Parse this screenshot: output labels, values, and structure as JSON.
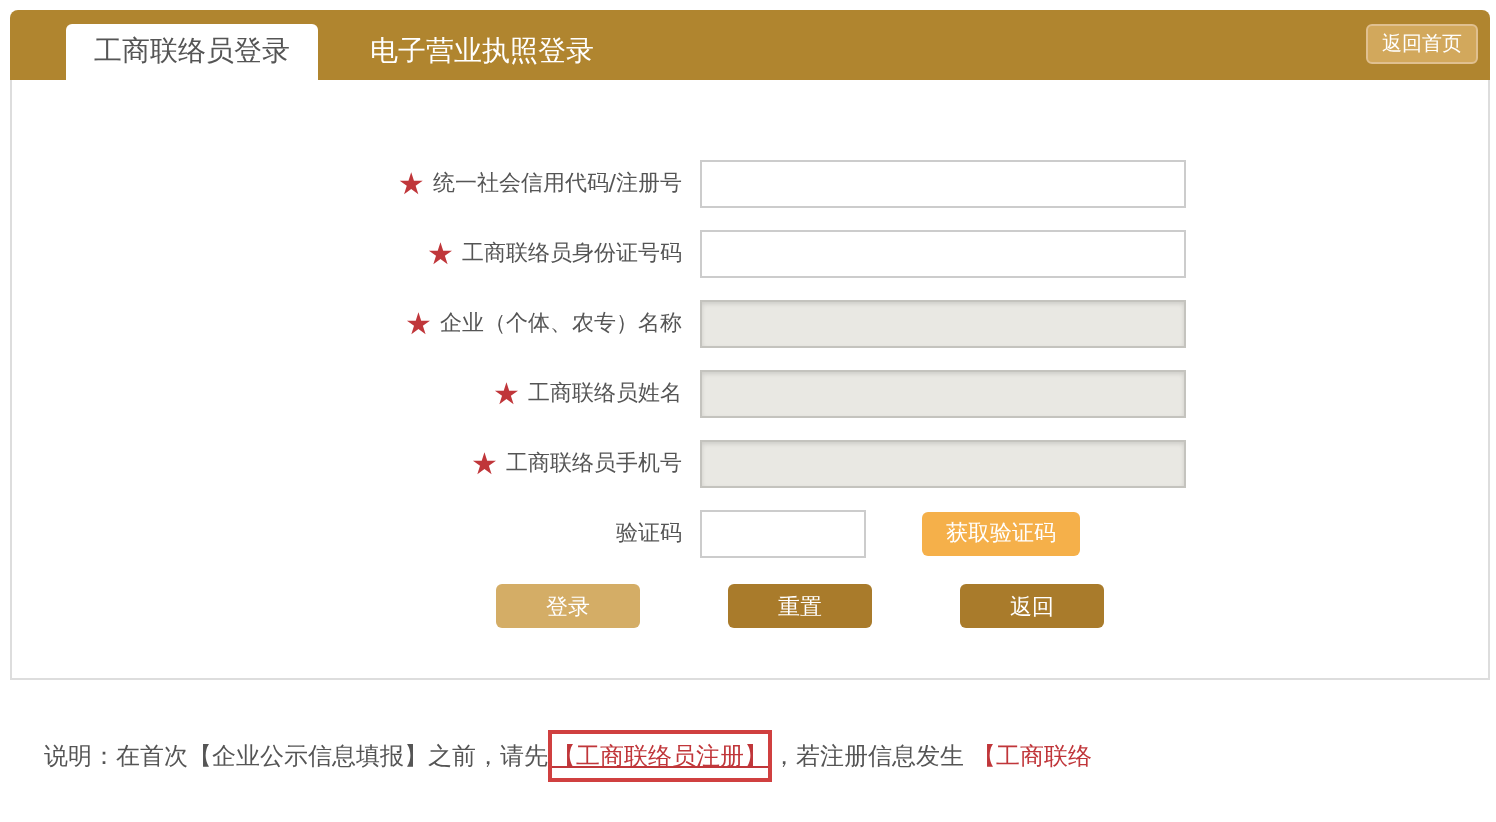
{
  "tabs": [
    {
      "label": "工商联络员登录",
      "selected": true
    },
    {
      "label": "电子营业执照登录",
      "selected": false
    }
  ],
  "home_button": "返回首页",
  "fields": [
    {
      "label": "统一社会信用代码/注册号",
      "required": true,
      "disabled": false
    },
    {
      "label": "工商联络员身份证号码",
      "required": true,
      "disabled": false
    },
    {
      "label": "企业（个体、农专）名称",
      "required": true,
      "disabled": true
    },
    {
      "label": "工商联络员姓名",
      "required": true,
      "disabled": true
    },
    {
      "label": "工商联络员手机号",
      "required": true,
      "disabled": true
    }
  ],
  "required_mark": "★",
  "captcha": {
    "label": "验证码",
    "button": "获取验证码"
  },
  "actions": [
    {
      "label": "登录",
      "disabled": true
    },
    {
      "label": "重置",
      "disabled": false
    },
    {
      "label": "返回",
      "disabled": false
    }
  ],
  "note": {
    "text": "说明：在首次【企业公示信息填报】之前，请先",
    "link": "【工商联络员注册】",
    "link_highlighted": true,
    "text_after": "，若注册信息发生",
    "link_2": "【工商联络"
  }
}
